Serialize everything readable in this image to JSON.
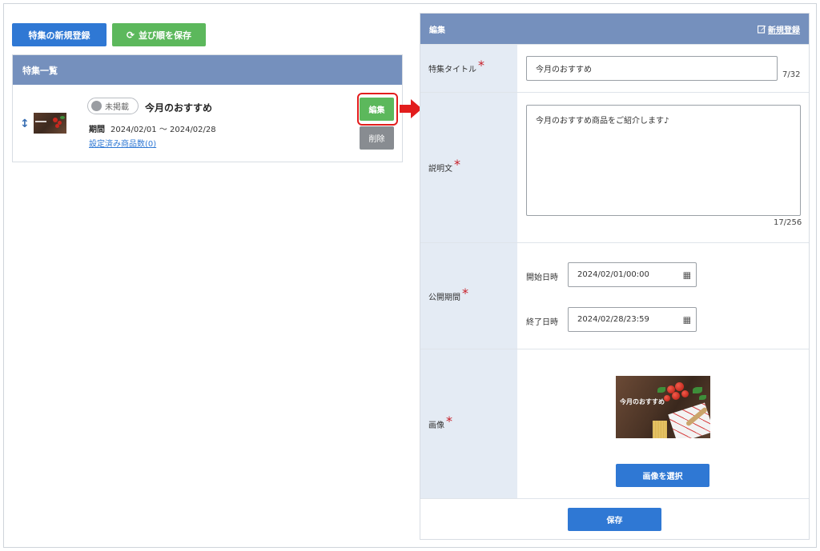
{
  "toolbar": {
    "new_label": "特集の新規登録",
    "order_label": "並び順を保存"
  },
  "list": {
    "header": "特集一覧",
    "item": {
      "status": "未掲載",
      "title": "今月のおすすめ",
      "period_label": "期間",
      "period_value": "2024/02/01 〜 2024/02/28",
      "count_link": "設定済み商品数(0)",
      "edit_label": "編集",
      "delete_label": "削除"
    }
  },
  "edit": {
    "header": "編集",
    "new_link": "新規登録",
    "title_label": "特集タイトル",
    "title_value": "今月のおすすめ",
    "title_counter": "7/32",
    "desc_label": "説明文",
    "desc_value": "今月のおすすめ商品をご紹介します♪",
    "desc_counter": "17/256",
    "period_label": "公開期間",
    "start_label": "開始日時",
    "start_value": "2024/02/01/00:00",
    "end_label": "終了日時",
    "end_value": "2024/02/28/23:59",
    "image_label": "画像",
    "image_overlay_text": "今月のおすすめ",
    "select_image_label": "画像を選択",
    "save_label": "保存",
    "required_mark": "*"
  },
  "colors": {
    "header_bg": "#7590bd",
    "primary_blue": "#2f78d4",
    "green": "#5cb85c",
    "gray": "#888c91",
    "label_bg": "#e4ebf4",
    "required": "#c7202a",
    "highlight": "#e21d1d"
  },
  "icons": [
    "refresh-icon",
    "sort-icon",
    "edit-square-icon",
    "calendar-icon",
    "right-arrow-icon"
  ]
}
